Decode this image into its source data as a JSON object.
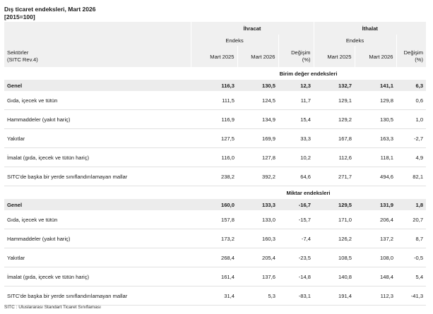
{
  "title": "Dış ticaret endeksleri, Mart 2026",
  "subtitle": "[2015=100]",
  "header": {
    "export": "İhracat",
    "import": "İthalat",
    "index": "Endeks",
    "sector_line1": "Sektörler",
    "sector_line2": "(SITC Rev.4)",
    "col_2025": "Mart 2025",
    "col_2026": "Mart 2026",
    "change_line1": "Değişim",
    "change_line2": "(%)"
  },
  "sections": [
    {
      "title": "Birim değer endeksleri",
      "rows": [
        {
          "label": "Genel",
          "values": [
            "116,3",
            "130,5",
            "12,3",
            "132,7",
            "141,1",
            "6,3"
          ]
        },
        {
          "label": "Gıda, içecek ve tütün",
          "values": [
            "111,5",
            "124,5",
            "11,7",
            "129,1",
            "129,8",
            "0,6"
          ]
        },
        {
          "label": "Hammaddeler (yakıt hariç)",
          "values": [
            "116,9",
            "134,9",
            "15,4",
            "129,2",
            "130,5",
            "1,0"
          ]
        },
        {
          "label": "Yakıtlar",
          "values": [
            "127,5",
            "169,9",
            "33,3",
            "167,8",
            "163,3",
            "-2,7"
          ]
        },
        {
          "label": "İmalat (gıda, içecek ve tütün hariç)",
          "values": [
            "116,0",
            "127,8",
            "10,2",
            "112,6",
            "118,1",
            "4,9"
          ]
        },
        {
          "label": "SITC'de başka bir yerde sınıflandırılamayan mallar",
          "values": [
            "238,2",
            "392,2",
            "64,6",
            "271,7",
            "494,6",
            "82,1"
          ]
        }
      ]
    },
    {
      "title": "Miktar endeksleri",
      "rows": [
        {
          "label": "Genel",
          "values": [
            "160,0",
            "133,3",
            "-16,7",
            "129,5",
            "131,9",
            "1,8"
          ]
        },
        {
          "label": "Gıda, içecek ve tütün",
          "values": [
            "157,8",
            "133,0",
            "-15,7",
            "171,0",
            "206,4",
            "20,7"
          ]
        },
        {
          "label": "Hammaddeler (yakıt hariç)",
          "values": [
            "173,2",
            "160,3",
            "-7,4",
            "126,2",
            "137,2",
            "8,7"
          ]
        },
        {
          "label": "Yakıtlar",
          "values": [
            "268,4",
            "205,4",
            "-23,5",
            "108,5",
            "108,0",
            "-0,5"
          ]
        },
        {
          "label": "İmalat (gıda, içecek ve tütün hariç)",
          "values": [
            "161,4",
            "137,6",
            "-14,8",
            "140,8",
            "148,4",
            "5,4"
          ]
        },
        {
          "label": "SITC'de başka bir yerde sınıflandırılamayan mallar",
          "values": [
            "31,4",
            "5,3",
            "-83,1",
            "191,4",
            "112,3",
            "-41,3"
          ]
        }
      ]
    }
  ],
  "footnote": "SITC : Uluslararası Standart Ticaret Sınıflaması"
}
